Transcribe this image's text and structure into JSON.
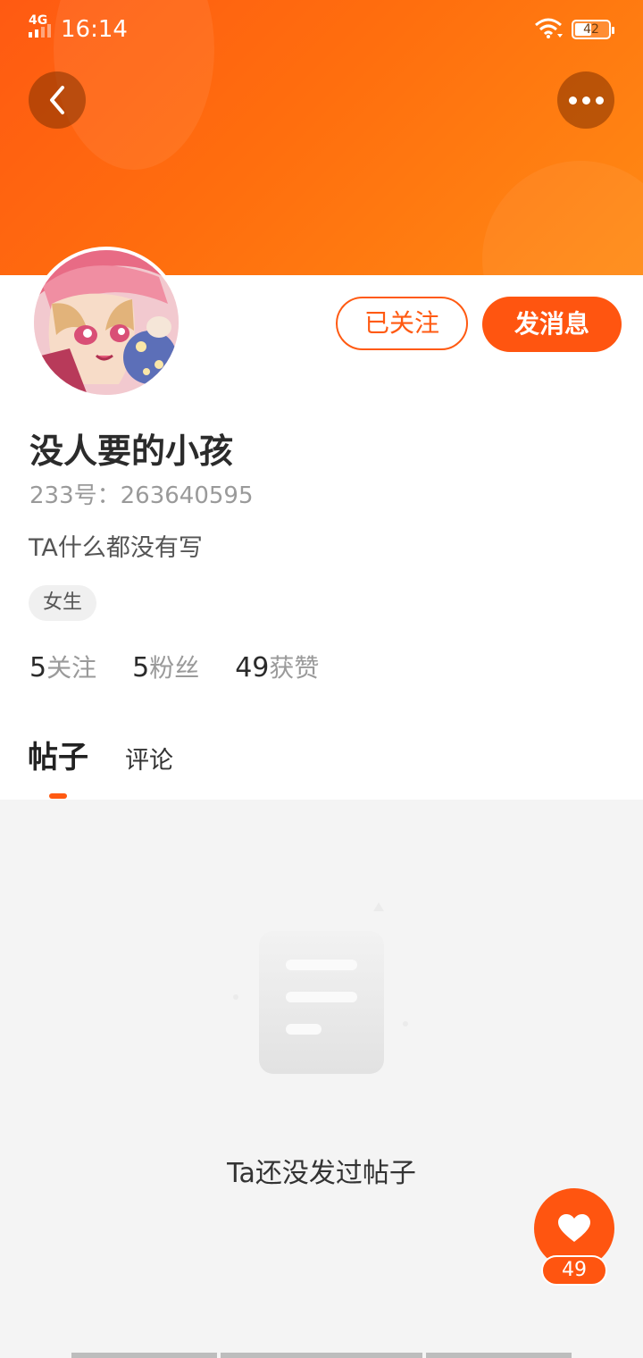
{
  "status_bar": {
    "network": "4G",
    "time": "16:14",
    "battery": "42",
    "icons": [
      "signal-icon",
      "wifi-icon",
      "battery-icon"
    ]
  },
  "header": {
    "back_icon": "chevron-left-icon",
    "more_icon": "more-dots-icon",
    "accent_color": "#ff5a12"
  },
  "profile": {
    "followed_label": "已关注",
    "message_label": "发消息",
    "username": "没人要的小孩",
    "user_id": "233号：263640595",
    "bio": "TA什么都没有写",
    "gender_tag": "女生",
    "stats": [
      {
        "num": "5",
        "label": "关注"
      },
      {
        "num": "5",
        "label": "粉丝"
      },
      {
        "num": "49",
        "label": "获赞"
      }
    ]
  },
  "tabs": [
    {
      "label": "帖子",
      "active": true
    },
    {
      "label": "评论",
      "active": false
    }
  ],
  "empty_state": {
    "icon": "document-icon",
    "text": "Ta还没发过帖子"
  },
  "like_fab": {
    "icon": "heart-icon",
    "count": "49"
  }
}
